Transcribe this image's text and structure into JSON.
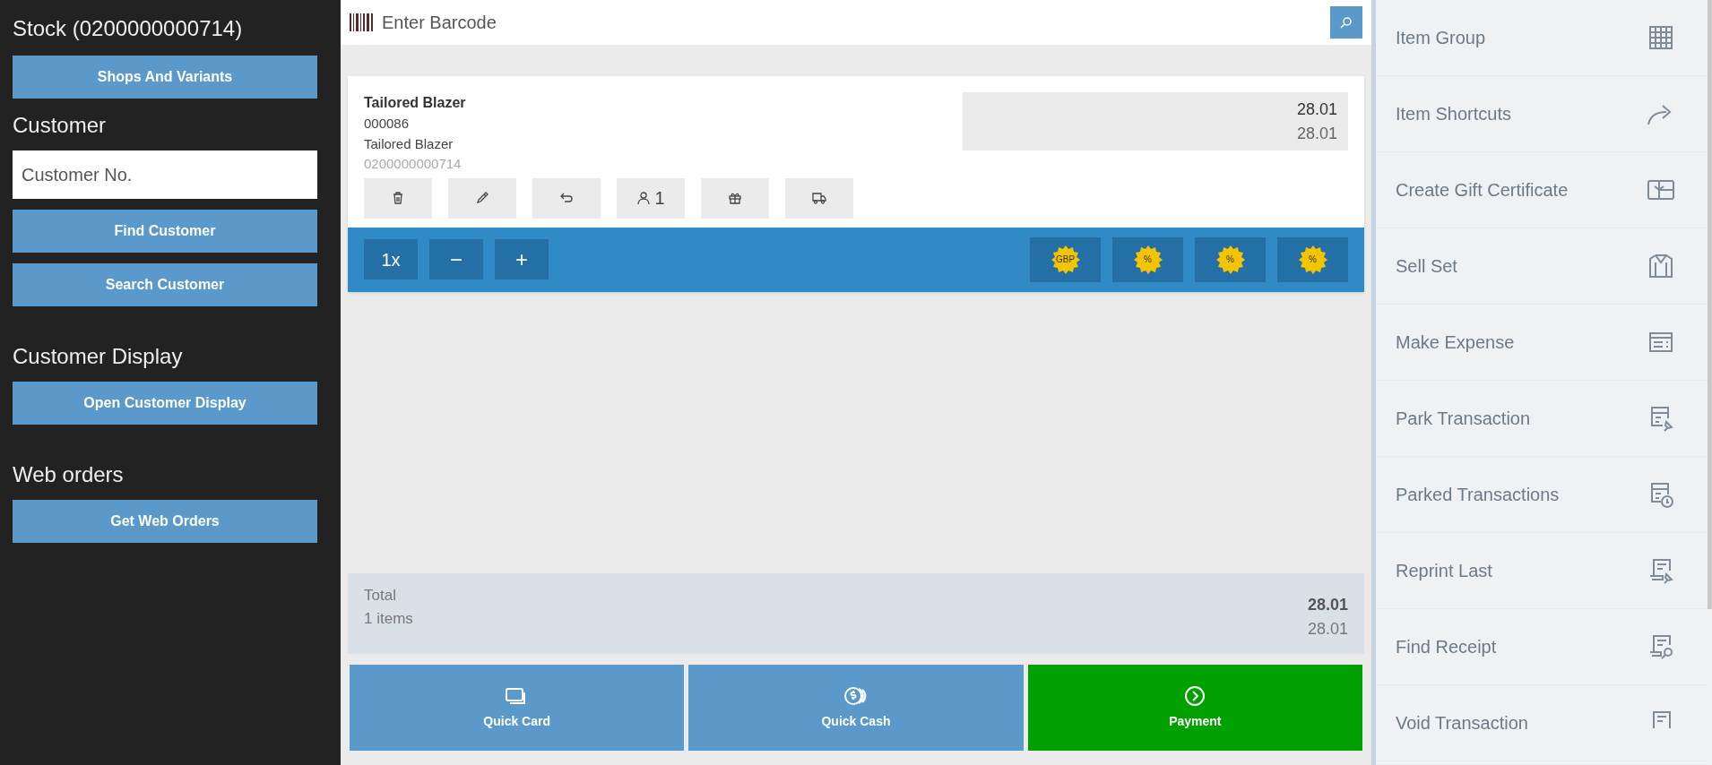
{
  "sidebar": {
    "sections": [
      {
        "heading": "Stock (0200000000714)",
        "controls": [
          {
            "kind": "button",
            "label": "Shops And Variants"
          }
        ]
      },
      {
        "heading": "Customer",
        "controls": [
          {
            "kind": "field",
            "placeholder": "Customer No."
          },
          {
            "kind": "button",
            "label": "Find Customer"
          },
          {
            "kind": "button",
            "label": "Search Customer"
          }
        ]
      },
      {
        "heading": "Customer Display",
        "controls": [
          {
            "kind": "button",
            "label": "Open Customer Display"
          }
        ]
      },
      {
        "heading": "Web orders",
        "controls": [
          {
            "kind": "button",
            "label": "Get Web Orders"
          }
        ]
      }
    ]
  },
  "barcode": {
    "placeholder": "Enter Barcode"
  },
  "line_item": {
    "name": "Tailored Blazer",
    "number": "000086",
    "description": "Tailored Blazer",
    "barcode": "0200000000714",
    "price": "28.01",
    "original_price": "28.01",
    "actions": [
      {
        "kind": "trash"
      },
      {
        "kind": "pencil"
      },
      {
        "kind": "return"
      },
      {
        "kind": "person",
        "label": "1"
      },
      {
        "kind": "gift"
      },
      {
        "kind": "truck"
      }
    ],
    "quantity": "1x",
    "quantity_controls": [
      "−",
      "+"
    ],
    "discounts": [
      "GBP",
      "%",
      "%",
      "%"
    ]
  },
  "total": {
    "label": "Total",
    "count": "1 items",
    "amount": "28.01",
    "original_amount": "28.01"
  },
  "pay_buttons": [
    {
      "kind": "card",
      "label": "Quick Card",
      "color": "#5a99c9"
    },
    {
      "kind": "cash",
      "label": "Quick Cash",
      "color": "#5a99c9"
    },
    {
      "kind": "payment",
      "label": "Payment",
      "color": "#00a000"
    }
  ],
  "menu": [
    {
      "kind": "grid",
      "label": "Item Group"
    },
    {
      "kind": "share",
      "label": "Item Shortcuts"
    },
    {
      "kind": "giftcard",
      "label": "Create Gift Certificate"
    },
    {
      "kind": "jacket",
      "label": "Sell Set"
    },
    {
      "kind": "expense",
      "label": "Make Expense"
    },
    {
      "kind": "park",
      "label": "Park Transaction"
    },
    {
      "kind": "parked",
      "label": "Parked Transactions"
    },
    {
      "kind": "reprint",
      "label": "Reprint Last"
    },
    {
      "kind": "find",
      "label": "Find Receipt"
    },
    {
      "kind": "void",
      "label": "Void Transaction"
    }
  ]
}
